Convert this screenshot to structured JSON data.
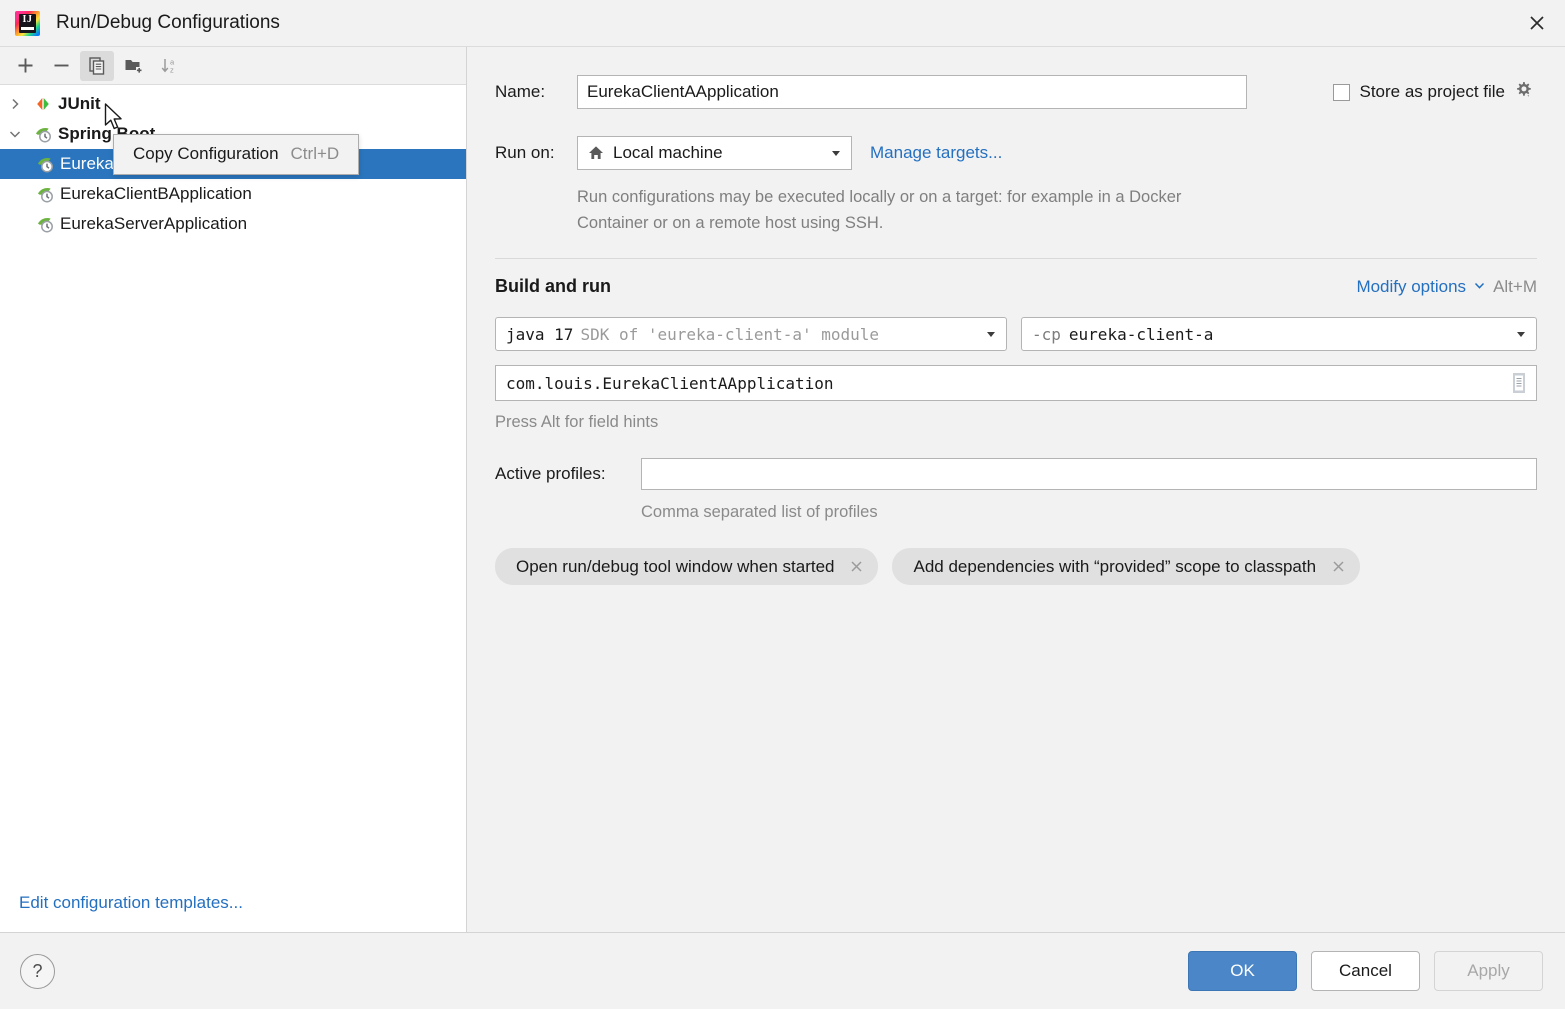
{
  "window": {
    "title": "Run/Debug Configurations",
    "logo_icon": "intellij-idea-logo",
    "close_icon": "close-icon"
  },
  "sidebar": {
    "toolbar": [
      {
        "name": "add",
        "icon": "plus-icon",
        "label": "+"
      },
      {
        "name": "remove",
        "icon": "minus-icon",
        "label": "−"
      },
      {
        "name": "copy-configuration",
        "icon": "copy-icon",
        "label": "Copy Configuration"
      },
      {
        "name": "new-folder",
        "icon": "new-folder-icon",
        "label": "New Folder"
      },
      {
        "name": "sort-alphabetically",
        "icon": "sort-az-icon",
        "label": "Sort Configurations"
      }
    ],
    "tooltip": {
      "label": "Copy Configuration",
      "shortcut": "Ctrl+D"
    },
    "tree": [
      {
        "label": "JUnit",
        "icon": "junit-icon",
        "expanded": false,
        "group": true,
        "chevron": "chevron-right-icon"
      },
      {
        "label": "Spring Boot",
        "icon": "spring-boot-icon",
        "expanded": true,
        "group": true,
        "chevron": "chevron-down-icon"
      },
      {
        "label": "EurekaClientAApplication",
        "icon": "spring-boot-icon",
        "child": true,
        "selected": true
      },
      {
        "label": "EurekaClientBApplication",
        "icon": "spring-boot-icon",
        "child": true,
        "selected": false
      },
      {
        "label": "EurekaServerApplication",
        "icon": "spring-boot-icon",
        "child": true,
        "selected": false
      }
    ],
    "edit_templates_link": "Edit configuration templates..."
  },
  "main": {
    "name_label": "Name:",
    "name_value": "EurekaClientAApplication",
    "store_as_project_file": {
      "label": "Store as project file",
      "checked": false,
      "gear_icon": "gear-icon"
    },
    "run_on_label": "Run on:",
    "run_on_value": "Local machine",
    "run_on_icon": "home-icon",
    "manage_targets_link": "Manage targets...",
    "help_text": "Run configurations may be executed locally or on a target: for example in a Docker Container or on a remote host using SSH.",
    "build_and_run": {
      "section_title": "Build and run",
      "modify_options_link": "Modify options",
      "modify_options_shortcut": "Alt+M",
      "sdk_main": "java 17",
      "sdk_dim": "SDK of 'eureka-client-a' module",
      "classpath_prefix": "-cp",
      "classpath_value": "eureka-client-a",
      "main_class": "com.louis.EurekaClientAApplication",
      "main_class_icon": "browse-class-icon",
      "field_hint": "Press Alt for field hints"
    },
    "active_profiles": {
      "label": "Active profiles:",
      "value": "",
      "placeholder": "",
      "hint": "Comma separated list of profiles"
    },
    "chips": [
      {
        "label": "Open run/debug tool window when started",
        "close_icon": "close-small-icon"
      },
      {
        "label": "Add dependencies with “provided” scope to classpath",
        "close_icon": "close-small-icon"
      }
    ]
  },
  "footer": {
    "help_label": "?",
    "help_icon": "help-icon",
    "ok_label": "OK",
    "cancel_label": "Cancel",
    "apply_label": "Apply"
  },
  "colors": {
    "selection_blue": "#2a75bd",
    "link_blue": "#2470c0",
    "ok_button": "#4a86c8",
    "dialog_bg": "#f2f2f2",
    "panel_white": "#ffffff",
    "chip_bg": "#e0e0e0"
  }
}
